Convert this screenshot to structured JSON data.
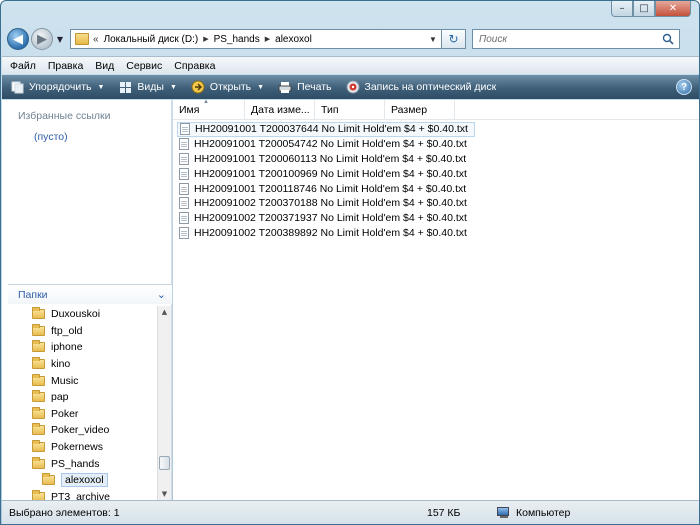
{
  "window": {
    "caption": {
      "minimize": "–",
      "maximize": "□",
      "close": "✕"
    }
  },
  "nav": {
    "back_glyph": "◀",
    "forward_glyph": "▶",
    "history_glyph": "▼"
  },
  "address": {
    "overflow": "«",
    "segments": [
      "Локальный диск (D:)",
      "PS_hands",
      "alexoxol"
    ],
    "separator": "▶",
    "dropdown_glyph": "▼",
    "refresh_glyph": "↻"
  },
  "search": {
    "placeholder": "Поиск"
  },
  "menu": {
    "items": [
      "Файл",
      "Правка",
      "Вид",
      "Сервис",
      "Справка"
    ]
  },
  "toolbar": {
    "organize": "Упорядочить",
    "views": "Виды",
    "open": "Открыть",
    "print": "Печать",
    "burn": "Запись на оптический диск",
    "dropdown_glyph": "▼",
    "help": "?"
  },
  "favorites": {
    "title": "Избранные ссылки",
    "empty": "(пусто)"
  },
  "folders": {
    "title": "Папки",
    "collapse_glyph": "⌄",
    "items": [
      {
        "label": "Duxouskoi",
        "sub": false,
        "selected": false
      },
      {
        "label": "ftp_old",
        "sub": false,
        "selected": false
      },
      {
        "label": "iphone",
        "sub": false,
        "selected": false
      },
      {
        "label": "kino",
        "sub": false,
        "selected": false
      },
      {
        "label": "Music",
        "sub": false,
        "selected": false
      },
      {
        "label": "pap",
        "sub": false,
        "selected": false
      },
      {
        "label": "Poker",
        "sub": false,
        "selected": false
      },
      {
        "label": "Poker_video",
        "sub": false,
        "selected": false
      },
      {
        "label": "Pokernews",
        "sub": false,
        "selected": false
      },
      {
        "label": "PS_hands",
        "sub": false,
        "selected": false
      },
      {
        "label": "alexoxol",
        "sub": true,
        "selected": true
      },
      {
        "label": "PT3_archive",
        "sub": false,
        "selected": false
      }
    ],
    "scroll_up": "▲",
    "scroll_down": "▼"
  },
  "columns": [
    {
      "label": "Имя"
    },
    {
      "label": "Дата изме..."
    },
    {
      "label": "Тип"
    },
    {
      "label": "Размер"
    }
  ],
  "sort_glyph": "▲",
  "files": [
    {
      "name": "HH20091001 T200037644 No Limit Hold'em $4 + $0.40.txt",
      "selected": true
    },
    {
      "name": "HH20091001 T200054742 No Limit Hold'em $4 + $0.40.txt",
      "selected": false
    },
    {
      "name": "HH20091001 T200060113 No Limit Hold'em $4 + $0.40.txt",
      "selected": false
    },
    {
      "name": "HH20091001 T200100969 No Limit Hold'em $4 + $0.40.txt",
      "selected": false
    },
    {
      "name": "HH20091001 T200118746 No Limit Hold'em $4 + $0.40.txt",
      "selected": false
    },
    {
      "name": "HH20091002 T200370188 No Limit Hold'em $4 + $0.40.txt",
      "selected": false
    },
    {
      "name": "HH20091002 T200371937 No Limit Hold'em $4 + $0.40.txt",
      "selected": false
    },
    {
      "name": "HH20091002 T200389892 No Limit Hold'em $4 + $0.40.txt",
      "selected": false
    }
  ],
  "status": {
    "selected": "Выбрано элементов: 1",
    "size": "157 КБ",
    "location": "Компьютер"
  }
}
